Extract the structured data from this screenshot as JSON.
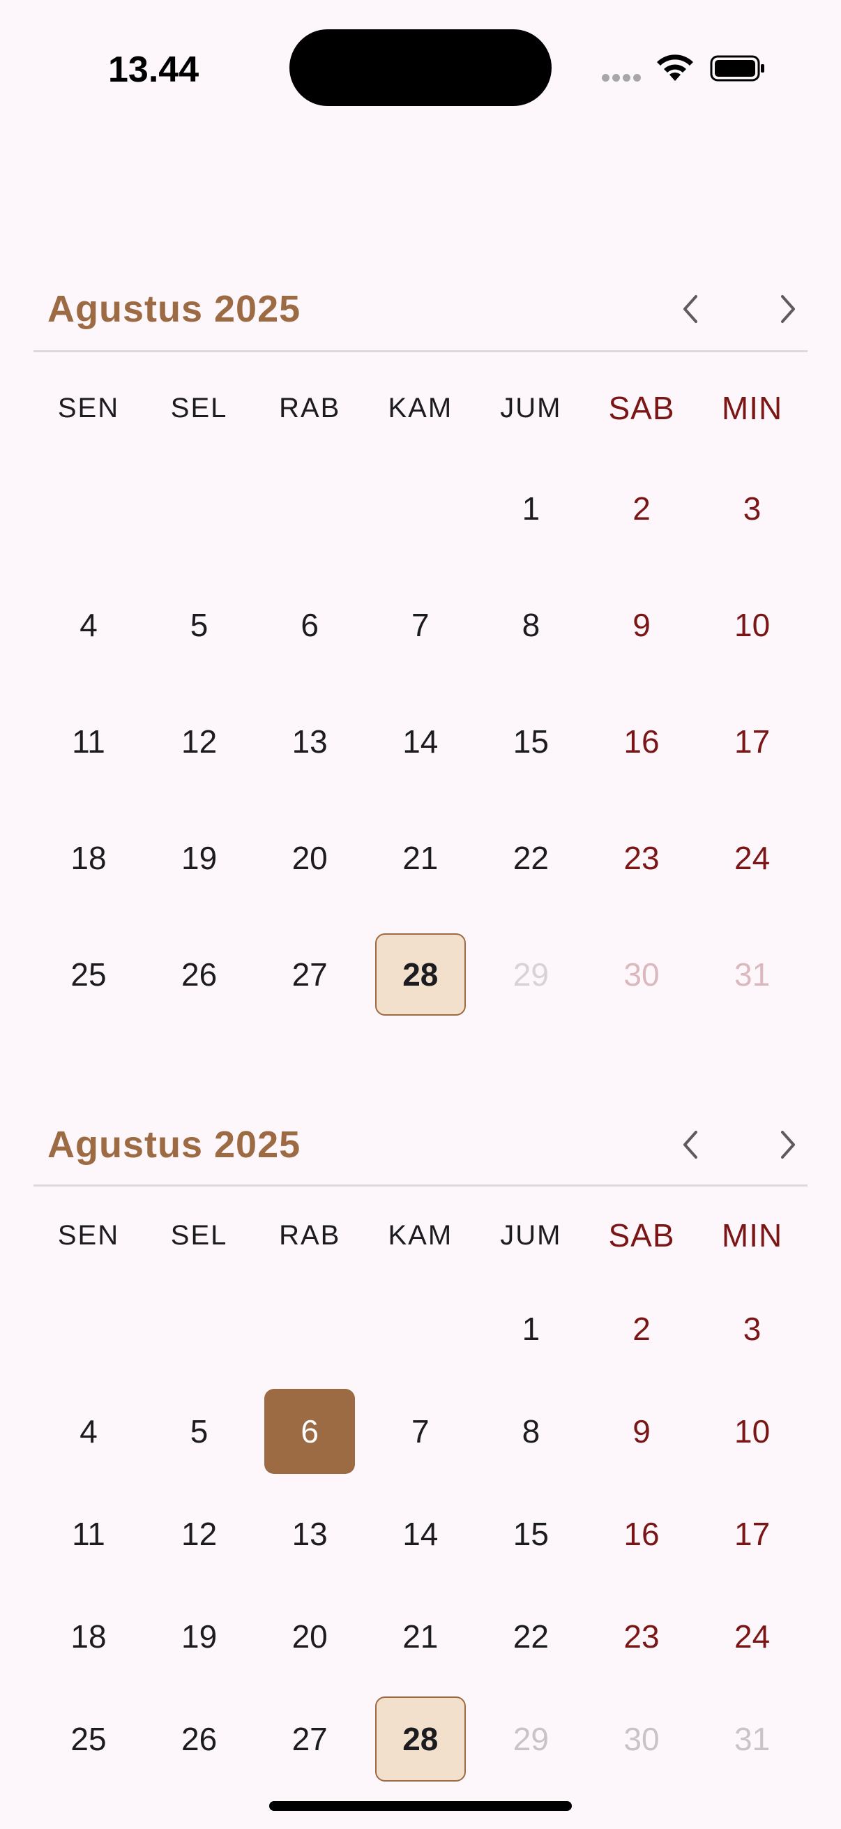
{
  "status": {
    "time": "13.44"
  },
  "weekdays": [
    "SEN",
    "SEL",
    "RAB",
    "KAM",
    "JUM",
    "SAB",
    "MIN"
  ],
  "calendars": [
    {
      "month_label": "Agustus 2025",
      "today": 28,
      "selected": null,
      "weeks": [
        [
          null,
          null,
          null,
          null,
          1,
          2,
          3
        ],
        [
          4,
          5,
          6,
          7,
          8,
          9,
          10
        ],
        [
          11,
          12,
          13,
          14,
          15,
          16,
          17
        ],
        [
          18,
          19,
          20,
          21,
          22,
          23,
          24
        ],
        [
          25,
          26,
          27,
          28,
          29,
          30,
          31
        ]
      ]
    },
    {
      "month_label": "Agustus 2025",
      "today": 28,
      "selected": 6,
      "weeks": [
        [
          null,
          null,
          null,
          null,
          1,
          2,
          3
        ],
        [
          4,
          5,
          6,
          7,
          8,
          9,
          10
        ],
        [
          11,
          12,
          13,
          14,
          15,
          16,
          17
        ],
        [
          18,
          19,
          20,
          21,
          22,
          23,
          24
        ],
        [
          25,
          26,
          27,
          28,
          29,
          30,
          31
        ]
      ]
    }
  ],
  "colors": {
    "accent": "#9c6b43",
    "weekend": "#7a1616",
    "today_bg": "#f2e0cd",
    "background": "#fdf7fc"
  },
  "icons": [
    "chevron-left-icon",
    "chevron-right-icon",
    "wifi-icon",
    "battery-icon",
    "cellular-signal-icon"
  ]
}
